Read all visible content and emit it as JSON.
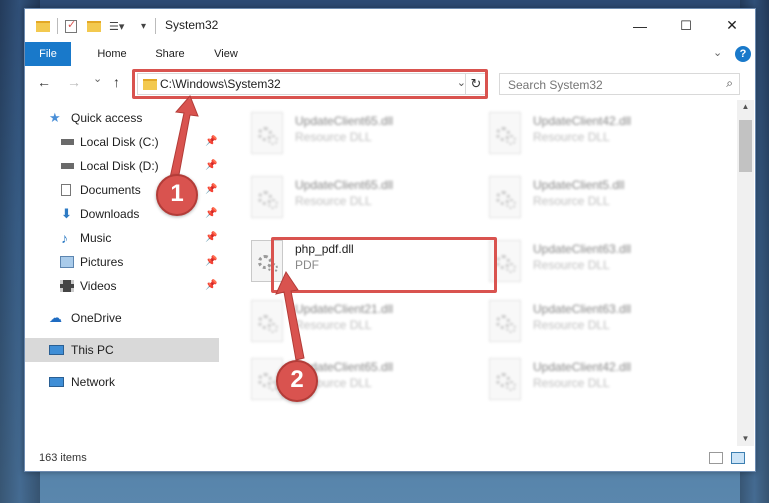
{
  "window": {
    "title": "System32"
  },
  "titlebar": {
    "minimize_glyph": "—",
    "maximize_glyph": "☐",
    "close_glyph": "✕"
  },
  "ribbon": {
    "tabs": [
      {
        "label": "File"
      },
      {
        "label": "Home"
      },
      {
        "label": "Share"
      },
      {
        "label": "View"
      }
    ],
    "help_glyph": "?"
  },
  "nav": {
    "back_glyph": "←",
    "forward_glyph": "→",
    "recent_glyph": "⌄",
    "up_glyph": "↑",
    "address": "C:\\Windows\\System32",
    "search_placeholder": "Search System32"
  },
  "sidebar": {
    "items": [
      {
        "label": "Quick access",
        "icon": "star-icon",
        "pinned": false
      },
      {
        "label": "Local Disk (C:)",
        "icon": "drive-icon",
        "pinned": true
      },
      {
        "label": "Local Disk (D:)",
        "icon": "drive-icon",
        "pinned": true
      },
      {
        "label": "Documents",
        "icon": "document-icon",
        "pinned": true
      },
      {
        "label": "Downloads",
        "icon": "download-icon",
        "pinned": true
      },
      {
        "label": "Music",
        "icon": "music-icon",
        "pinned": true
      },
      {
        "label": "Pictures",
        "icon": "pictures-icon",
        "pinned": true
      },
      {
        "label": "Videos",
        "icon": "video-icon",
        "pinned": true
      },
      {
        "label": "OneDrive",
        "icon": "cloud-icon",
        "pinned": false
      },
      {
        "label": "This PC",
        "icon": "computer-icon",
        "pinned": false,
        "selected": true
      },
      {
        "label": "Network",
        "icon": "network-icon",
        "pinned": false
      }
    ]
  },
  "files": [
    {
      "name": "UpdateClient65.dll",
      "type": "Resource DLL"
    },
    {
      "name": "UpdateClient42.dll",
      "type": "Resource DLL"
    },
    {
      "name": "UpdateClient65.dll",
      "type": "Resource DLL"
    },
    {
      "name": "UpdateClient5.dll",
      "type": "Resource DLL"
    },
    {
      "name": "php_pdf.dll",
      "type": "PDF"
    },
    {
      "name": "UpdateClient63.dll",
      "type": "Resource DLL"
    },
    {
      "name": "UpdateClient21.dll",
      "type": "Resource DLL"
    },
    {
      "name": "UpdateClient63.dll",
      "type": "Resource DLL"
    },
    {
      "name": "UpdateClient65.dll",
      "type": "Resource DLL"
    },
    {
      "name": "UpdateClient42.dll",
      "type": "Resource DLL"
    }
  ],
  "status": {
    "item_count": "163 items"
  },
  "annotations": {
    "step1": "1",
    "step2": "2",
    "color": "#d9534f"
  }
}
